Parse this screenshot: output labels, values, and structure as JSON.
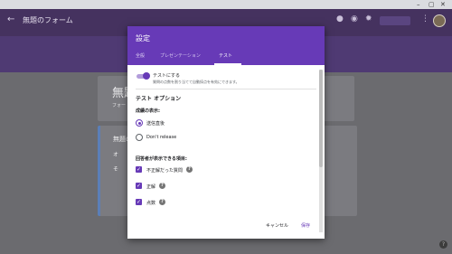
{
  "window": {
    "controls": [
      "–",
      "▢",
      "✕"
    ]
  },
  "appbar": {
    "title": "無題のフォーム"
  },
  "background_form": {
    "title": "無題",
    "description": "フォー",
    "question_title": "無題の",
    "options": [
      "オ",
      "そ"
    ]
  },
  "dialog": {
    "title": "設定",
    "tabs": [
      {
        "label": "全般"
      },
      {
        "label": "プレゼンテーション"
      },
      {
        "label": "テスト"
      }
    ],
    "quiz_toggle": {
      "label": "テストにする",
      "description": "質問の点数を割り当てて自動採点を有効にできます。"
    },
    "section_title": "テスト オプション",
    "grade_release": {
      "heading": "成績の表示:",
      "options": [
        {
          "label": "送信直後",
          "selected": true
        },
        {
          "label": "Don't release",
          "selected": false
        }
      ]
    },
    "respondent_can_see": {
      "heading": "回答者が表示できる項目:",
      "items": [
        {
          "label": "不正解だった質問",
          "checked": true
        },
        {
          "label": "正解",
          "checked": true
        },
        {
          "label": "点数",
          "checked": true
        }
      ]
    },
    "cancel_label": "キャンセル",
    "save_label": "保存"
  },
  "colors": {
    "accent": "#673ab7",
    "appbar": "#45325f"
  }
}
